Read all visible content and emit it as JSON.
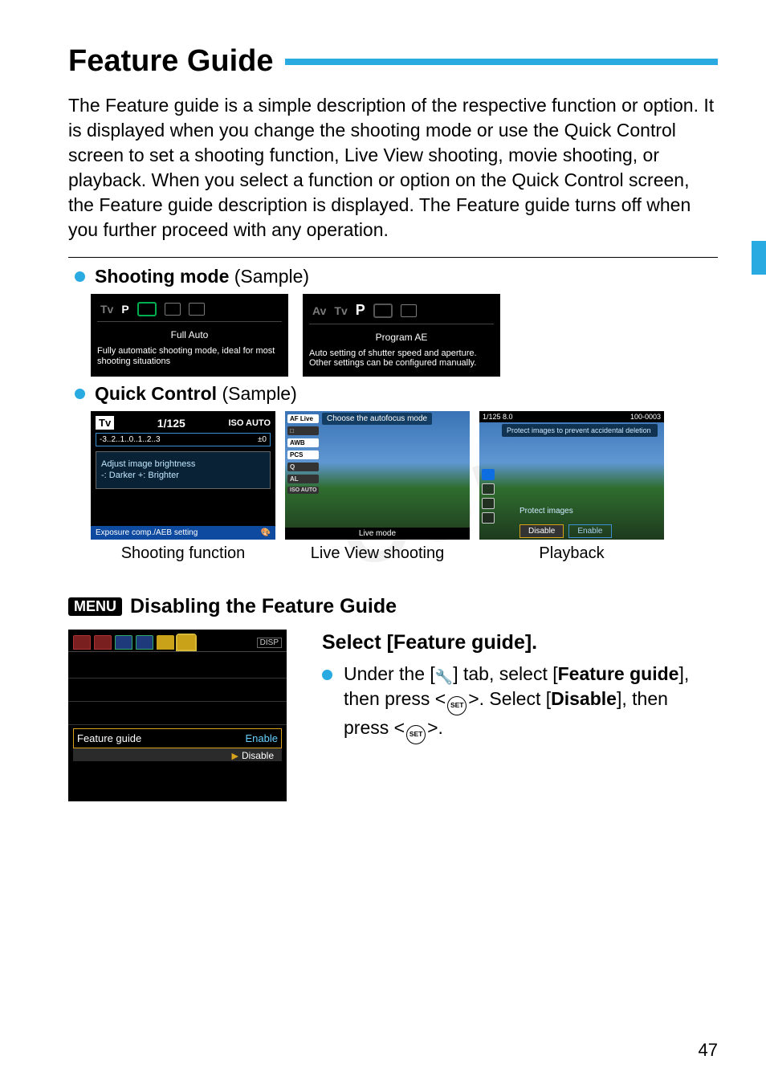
{
  "page": {
    "title": "Feature Guide",
    "intro": "The Feature guide is a simple description of the respective function or option. It is displayed when you change the shooting mode or use the Quick Control screen to set a shooting function, Live View shooting, movie shooting, or playback. When you select a function or option on the Quick Control screen, the Feature guide description is displayed. The Feature guide turns off when you further proceed with any operation.",
    "number": "47",
    "watermark": "COPY"
  },
  "section1": {
    "heading_bold": "Shooting mode",
    "heading_rest": " (Sample)",
    "left": {
      "icons": [
        "Tv",
        "P"
      ],
      "title": "Full Auto",
      "desc": "Fully automatic shooting mode, ideal for most shooting situations"
    },
    "right": {
      "icons": [
        "Av",
        "Tv",
        "P"
      ],
      "title": "Program AE",
      "desc": "Auto setting of shutter speed and aperture. Other settings can be configured manually."
    }
  },
  "section2": {
    "heading_bold": "Quick Control",
    "heading_rest": " (Sample)",
    "captions": [
      "Shooting function",
      "Live View shooting",
      "Playback"
    ],
    "qc1": {
      "tv": "Tv",
      "shutter": "1/125",
      "iso": "ISO AUTO",
      "scale": "-3..2..1..0..1..2..3",
      "ev": "±0",
      "help": "Adjust image brightness\n-: Darker  +: Brighter",
      "bottom": "Exposure comp./AEB setting"
    },
    "qc2": {
      "tooltip": "Choose the autofocus mode",
      "icons": [
        "AF Live",
        "□",
        "AWB",
        "PCS",
        "Q",
        "AL",
        "ISO AUTO"
      ],
      "bottom": "Live mode"
    },
    "qc3": {
      "top_left": "1/125   8.0",
      "top_right": "100-0003",
      "tip": "Protect images to prevent accidental deletion",
      "label": "Protect images",
      "btn_disable": "Disable",
      "btn_enable": "Enable"
    }
  },
  "menu": {
    "badge": "MENU",
    "heading": "Disabling the Feature Guide",
    "lcd": {
      "disp": "DISP",
      "row_label": "Feature guide",
      "row_value": "Enable",
      "sub_value": "Disable"
    },
    "instructions": {
      "title": "Select [Feature guide].",
      "line1a": "Under the [",
      "line1b": "] tab, select [",
      "line1c": "Feature guide",
      "line1d": "], then press <",
      "line1e": ">. Select [",
      "line1f": "Disable",
      "line1g": "], then press <",
      "line1h": ">.",
      "set": "SET"
    }
  }
}
